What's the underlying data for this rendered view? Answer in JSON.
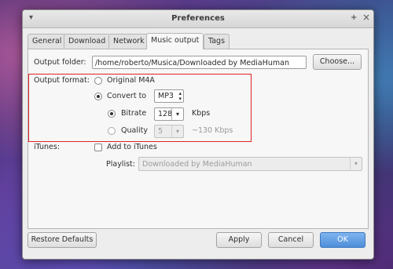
{
  "window": {
    "title": "Preferences",
    "menu_glyph": "▾",
    "pin_glyph": "+",
    "close_glyph": "×"
  },
  "tabs": [
    {
      "label": "General"
    },
    {
      "label": "Download"
    },
    {
      "label": "Network"
    },
    {
      "label": "Music output",
      "active": true
    },
    {
      "label": "Tags"
    }
  ],
  "output_folder": {
    "label": "Output folder:",
    "value": "/home/roberto/Musica/Downloaded by MediaHuman",
    "choose_label": "Choose..."
  },
  "output_format": {
    "label": "Output format:",
    "original_label": "Original M4A",
    "original_selected": false,
    "convert_label": "Convert to",
    "convert_selected": true,
    "convert_format": "MP3",
    "spin_up": "▴",
    "spin_down": "▾",
    "bitrate_label": "Bitrate",
    "bitrate_selected": true,
    "bitrate_value": "128",
    "bitrate_unit": "Kbps",
    "quality_label": "Quality",
    "quality_selected": false,
    "quality_value": "5",
    "quality_note": "~130 Kbps",
    "dropdown_glyph": "▾"
  },
  "itunes": {
    "label": "iTunes:",
    "add_label": "Add to iTunes",
    "add_checked": false,
    "playlist_label": "Playlist:",
    "playlist_value": "Downloaded by MediaHuman"
  },
  "buttons": {
    "restore": "Restore Defaults",
    "apply": "Apply",
    "cancel": "Cancel",
    "ok": "OK"
  },
  "colors": {
    "highlight_box": "#e02424",
    "ok_button": "#4f8fd9"
  }
}
